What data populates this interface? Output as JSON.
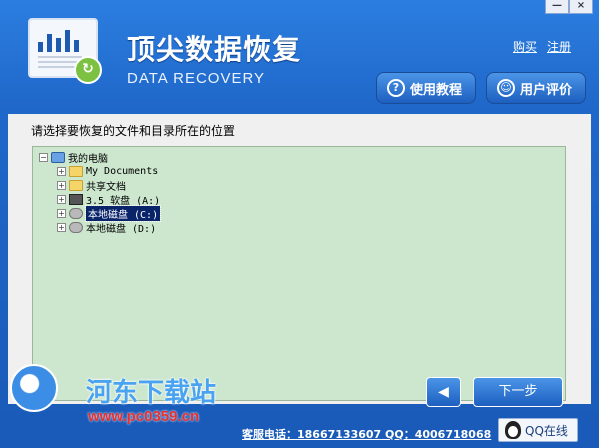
{
  "window": {
    "minimize_glyph": "—",
    "close_glyph": "×"
  },
  "header": {
    "title_cn": "顶尖数据恢复",
    "title_en": "DATA RECOVERY",
    "links": {
      "buy": "购买",
      "register": "注册"
    },
    "buttons": {
      "tutorial": "使用教程",
      "review": "用户评价"
    }
  },
  "panel": {
    "label": "请选择要恢复的文件和目录所在的位置",
    "tree": {
      "root": "我的电脑",
      "items": [
        {
          "label": "My Documents",
          "icon": "folder-icon"
        },
        {
          "label": "共享文档",
          "icon": "folder-icon"
        },
        {
          "label": "3.5 软盘 (A:)",
          "icon": "floppy-icon"
        },
        {
          "label": "本地磁盘 (C:)",
          "icon": "disk-icon",
          "selected": true
        },
        {
          "label": "本地磁盘 (D:)",
          "icon": "disk-icon"
        }
      ]
    }
  },
  "nav": {
    "back_glyph": "◀",
    "next_label": "下一步"
  },
  "footer": {
    "contact": "客服电话：18667133607 QQ：4006718068",
    "qq_label": "QQ在线"
  },
  "watermark": {
    "text_cn": "河东下载站",
    "url": "www.pc0359.cn"
  },
  "colors": {
    "accent": "#1f67c9",
    "tree_bg": "#cde7cf",
    "selection": "#0a246a"
  }
}
